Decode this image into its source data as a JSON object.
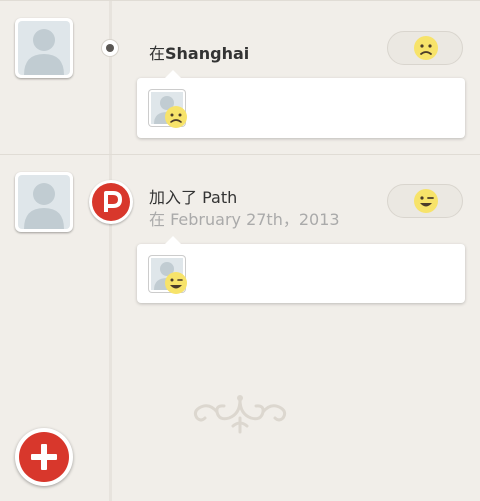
{
  "timeline": {
    "moments": [
      {
        "title_prefix": "在",
        "title_place": "Shanghai",
        "subtitle": "",
        "mood_icon": "sad-face-icon"
      },
      {
        "title": "加入了 Path",
        "subtitle": "在 February 27th，2013",
        "badge_icon": "path-logo-icon",
        "mood_icon": "wink-face-icon"
      }
    ]
  },
  "colors": {
    "background": "#f1eee9",
    "path_red": "#d8372c",
    "emoji_yellow": "#f7e36a",
    "timeline_dot": "#5a5754"
  },
  "actions": {
    "add_icon": "plus-icon"
  }
}
